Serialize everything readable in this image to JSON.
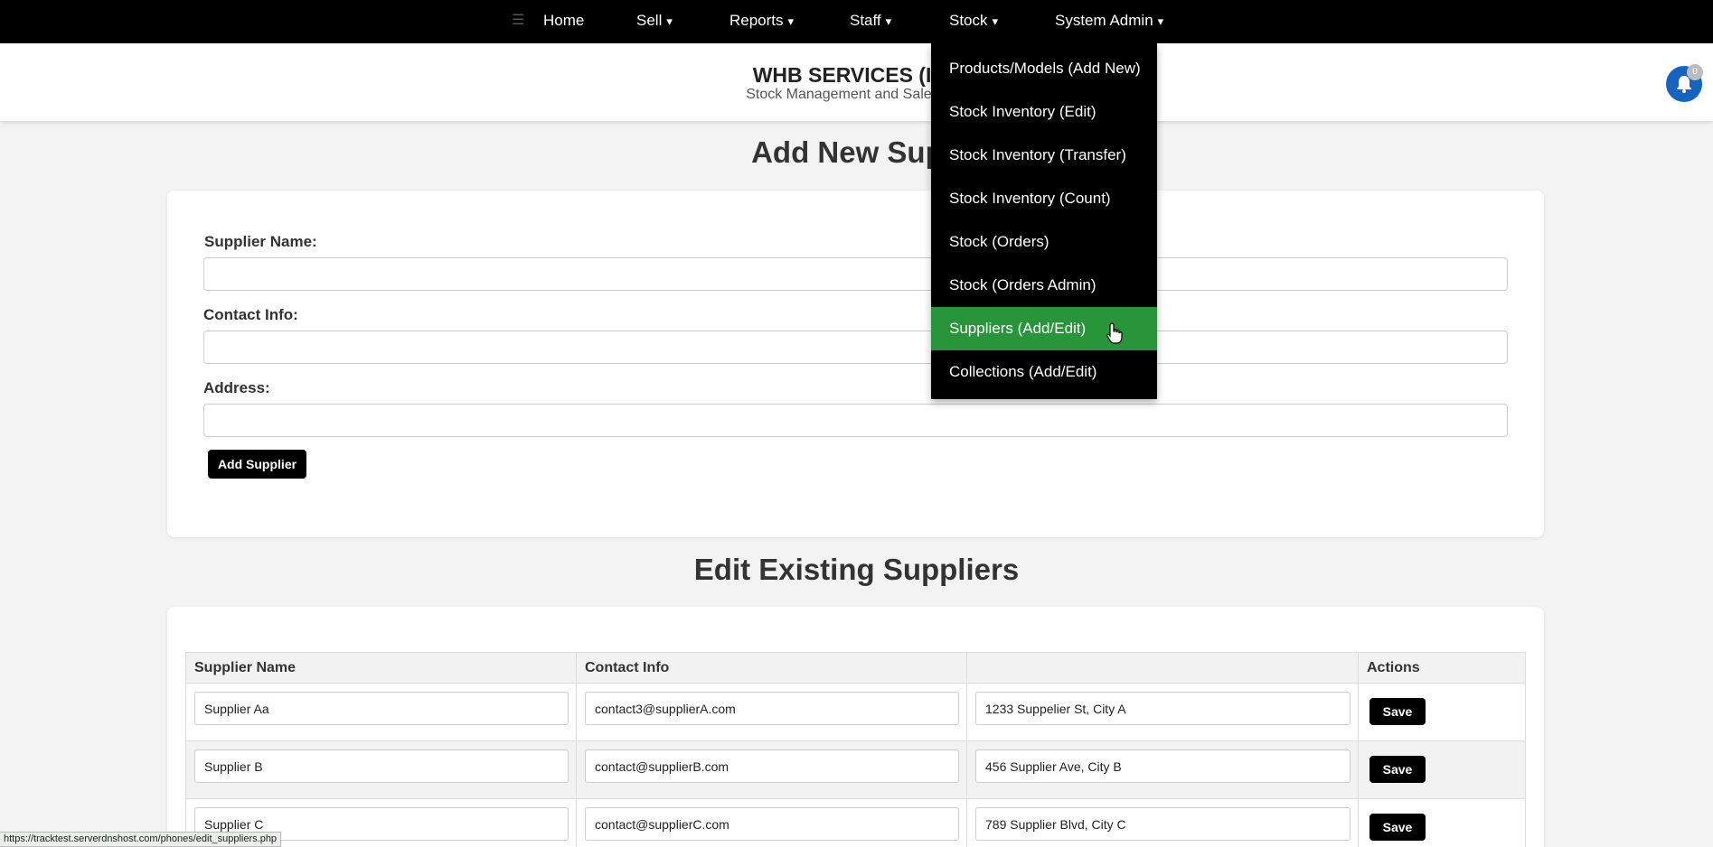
{
  "nav": {
    "home": "Home",
    "sell": "Sell",
    "reports": "Reports",
    "staff": "Staff",
    "stock": "Stock",
    "system_admin": "System Admin",
    "caret": "▾",
    "hamburger": "☰"
  },
  "header": {
    "title": "WHB SERVICES (IRE",
    "subtitle": "Stock Management and Sales Sys",
    "notification_count": "0"
  },
  "add_section": {
    "title": "Add New Supp",
    "name_label": "Supplier Name:",
    "contact_label": "Contact Info:",
    "address_label": "Address:",
    "name_value": "",
    "contact_value": "",
    "address_value": "",
    "button_label": "Add Supplier"
  },
  "edit_section": {
    "title": "Edit Existing Suppliers",
    "columns": [
      "Supplier Name",
      "Contact Info",
      "",
      "Actions"
    ],
    "rows": [
      {
        "name": "Supplier Aa",
        "contact": "contact3@supplierA.com",
        "address": "1233 Suppelier St, City A",
        "action": "Save"
      },
      {
        "name": "Supplier B",
        "contact": "contact@supplierB.com",
        "address": "456 Supplier Ave, City B",
        "action": "Save"
      },
      {
        "name": "Supplier C",
        "contact": "contact@supplierC.com",
        "address": "789 Supplier Blvd, City C",
        "action": "Save"
      }
    ]
  },
  "stock_menu": {
    "items": [
      "Products/Models (Add New)",
      "Stock Inventory (Edit)",
      "Stock Inventory (Transfer)",
      "Stock Inventory (Count)",
      "Stock (Orders)",
      "Stock (Orders Admin)",
      "Suppliers (Add/Edit)",
      "Collections (Add/Edit)"
    ],
    "active_index": 6
  },
  "status_bar": {
    "url": "https://tracktest.serverdnshost.com/phones/edit_suppliers.php"
  },
  "colors": {
    "nav_bg": "#000000",
    "active_menu": "#28953a",
    "bell": "#1565c0"
  },
  "icons": {
    "menu": "hamburger-icon",
    "notification": "bell-icon",
    "cursor": "hand-pointer-cursor"
  }
}
